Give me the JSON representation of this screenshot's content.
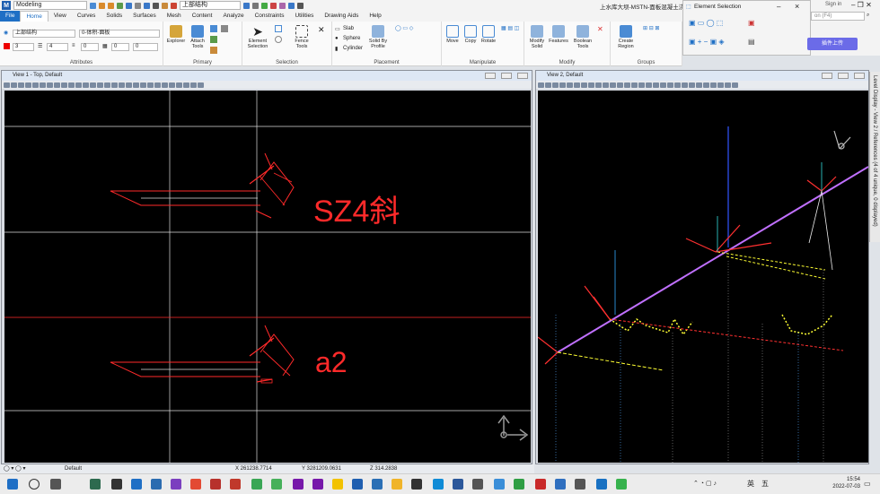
{
  "app": {
    "workspace": "Modeling",
    "window_title": "上水库大坝-MSTN-面板混凝土浇筑",
    "sign_in": "Sign in",
    "level_qat": "上部结构",
    "help_search": "on (F4)"
  },
  "menu": [
    "File",
    "Home",
    "View",
    "Curves",
    "Solids",
    "Surfaces",
    "Mesh",
    "Content",
    "Analyze",
    "Constraints",
    "Utilities",
    "Drawing Aids",
    "Help"
  ],
  "ribbon": {
    "attributes": {
      "level": "上部结构",
      "style": "0-体积-面板",
      "color": "3",
      "weight": "4",
      "linestyle": "0",
      "transparency": "0",
      "priority": "0",
      "label": "Attributes"
    },
    "primary": {
      "explorer": "Explorer",
      "attach_tools": "Attach Tools",
      "label": "Primary"
    },
    "selection": {
      "element_selection": "Element Selection",
      "fence": "Fence",
      "fence_tools": "Tools",
      "label": "Selection"
    },
    "placement": {
      "slab": "Slab",
      "sphere": "Sphere",
      "cylinder": "Cylinder",
      "solid_by_profile": "Solid By Profile",
      "label": "Placement"
    },
    "manipulate": {
      "move": "Move",
      "copy": "Copy",
      "rotate": "Rotate",
      "label": "Manipulate"
    },
    "modify": {
      "modify_solid": "Modify Solid",
      "features": "Features",
      "boolean_tools": "Boolean Tools",
      "label": "Modify"
    },
    "groups": {
      "create_region": "Create Region",
      "label": "Groups"
    },
    "plugin_button": "插件上传"
  },
  "element_selection": {
    "title": "Element Selection"
  },
  "views": {
    "view1": {
      "title": "View 1 - Top, Default",
      "text_top": "SZ4斜",
      "text_bottom": "a2"
    },
    "view2": {
      "title": "View 2, Default"
    }
  },
  "side_tab": "Level Display - View 2 / References (4 of 4 unique, 0 displayed)",
  "status": {
    "model": "Default",
    "x": "X 261238.7714",
    "y": "Y 3281209.0631",
    "z": "Z 314.2838"
  },
  "taskbar": {
    "ime": "英",
    "ime2": "五",
    "time": "15:54",
    "date": "2022-07-03"
  },
  "colors": {
    "accent": "#1f6fc5",
    "canvas": "#000000",
    "red": "#ff2020",
    "yellow": "#ffff33",
    "magenta": "#d080ff"
  }
}
